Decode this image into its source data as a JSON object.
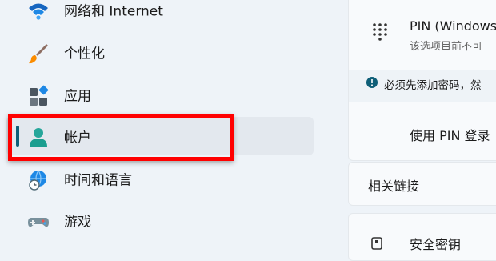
{
  "sidebar": {
    "items": [
      {
        "label": "网络和 Internet",
        "icon": "wifi-icon"
      },
      {
        "label": "个性化",
        "icon": "paintbrush-icon"
      },
      {
        "label": "应用",
        "icon": "apps-icon"
      },
      {
        "label": "帐户",
        "icon": "account-icon",
        "selected": true
      },
      {
        "label": "时间和语言",
        "icon": "globe-clock-icon"
      },
      {
        "label": "游戏",
        "icon": "gamepad-icon"
      }
    ]
  },
  "content": {
    "pin_title": "PIN (Windows",
    "pin_subtitle": "该选项目前不可",
    "pin_icon": "keypad-icon",
    "warning_text": "必须先添加密码，然",
    "warning_icon": "info-icon",
    "signin_label": "使用 PIN 登录",
    "related_links_title": "相关链接",
    "security_key_label": "安全密钥",
    "security_key_icon": "key-icon"
  },
  "colors": {
    "background": "#eef3f8",
    "selected_bg": "#e3e8ee",
    "accent": "#0f5f78",
    "highlight": "#ff0000",
    "card_bg": "#f8fafc"
  }
}
